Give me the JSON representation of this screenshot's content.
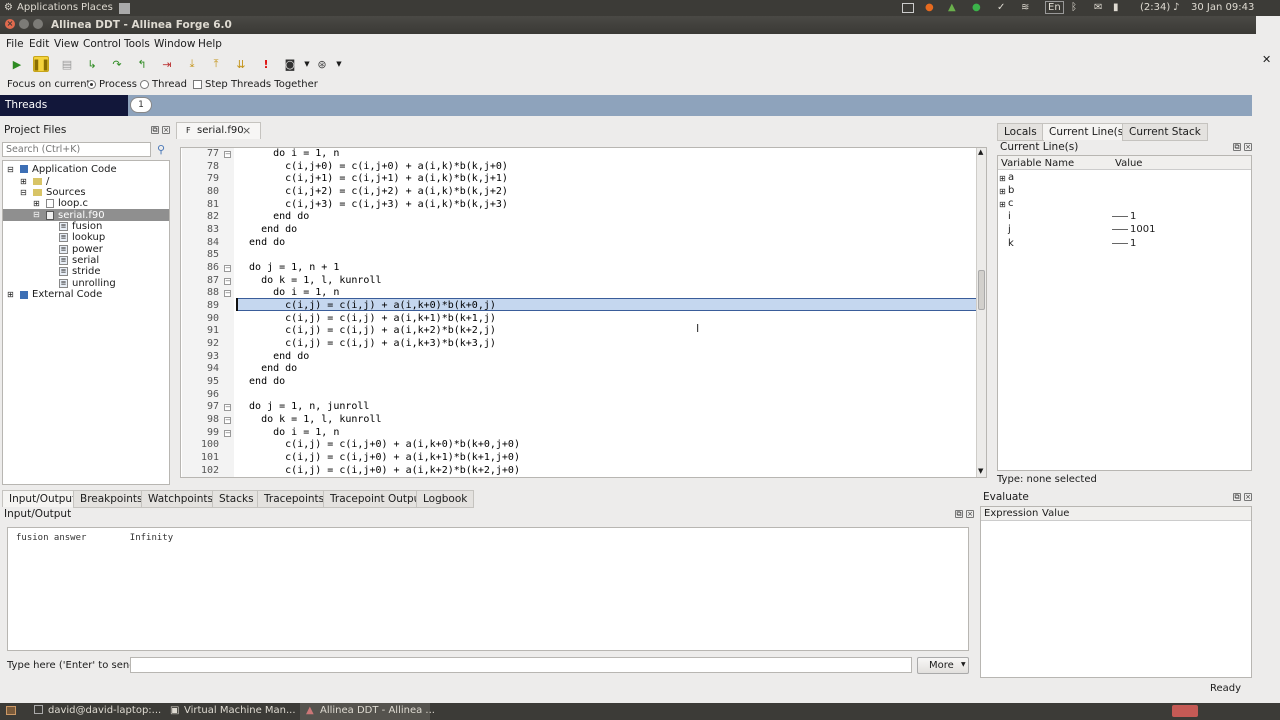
{
  "topbar": {
    "applications": "Applications",
    "places": "Places",
    "battery": "(2:34)",
    "lang": "En",
    "datetime": "30 Jan 09:43"
  },
  "window": {
    "title": "Allinea DDT - Allinea Forge 6.0"
  },
  "menu": [
    "File",
    "Edit",
    "View",
    "Control",
    "Tools",
    "Window",
    "Help"
  ],
  "focus": {
    "label": "Focus on current:",
    "process": "Process",
    "thread": "Thread",
    "step": "Step Threads Together"
  },
  "threads": {
    "label": "Threads",
    "count": "1"
  },
  "project": {
    "title": "Project Files",
    "search_placeholder": "Search (Ctrl+K)",
    "app_code": "Application Code",
    "root": "/",
    "sources": "Sources",
    "files": [
      "loop.c",
      "serial.f90"
    ],
    "functions": [
      "fusion",
      "lookup",
      "power",
      "serial",
      "stride",
      "unrolling"
    ],
    "external": "External Code"
  },
  "editor": {
    "tab": "serial.f90",
    "lines": [
      {
        "n": "77",
        "t": "      do i = 1, n"
      },
      {
        "n": "78",
        "t": "        c(i,j+0) = c(i,j+0) + a(i,k)*b(k,j+0)"
      },
      {
        "n": "79",
        "t": "        c(i,j+1) = c(i,j+1) + a(i,k)*b(k,j+1)"
      },
      {
        "n": "80",
        "t": "        c(i,j+2) = c(i,j+2) + a(i,k)*b(k,j+2)"
      },
      {
        "n": "81",
        "t": "        c(i,j+3) = c(i,j+3) + a(i,k)*b(k,j+3)"
      },
      {
        "n": "82",
        "t": "      end do"
      },
      {
        "n": "83",
        "t": "    end do"
      },
      {
        "n": "84",
        "t": "  end do"
      },
      {
        "n": "85",
        "t": ""
      },
      {
        "n": "86",
        "t": "  do j = 1, n + 1"
      },
      {
        "n": "87",
        "t": "    do k = 1, l, kunroll"
      },
      {
        "n": "88",
        "t": "      do i = 1, n"
      },
      {
        "n": "89",
        "t": "        c(i,j) = c(i,j) + a(i,k+0)*b(k+0,j)"
      },
      {
        "n": "90",
        "t": "        c(i,j) = c(i,j) + a(i,k+1)*b(k+1,j)"
      },
      {
        "n": "91",
        "t": "        c(i,j) = c(i,j) + a(i,k+2)*b(k+2,j)"
      },
      {
        "n": "92",
        "t": "        c(i,j) = c(i,j) + a(i,k+3)*b(k+3,j)"
      },
      {
        "n": "93",
        "t": "      end do"
      },
      {
        "n": "94",
        "t": "    end do"
      },
      {
        "n": "95",
        "t": "  end do"
      },
      {
        "n": "96",
        "t": ""
      },
      {
        "n": "97",
        "t": "  do j = 1, n, junroll"
      },
      {
        "n": "98",
        "t": "    do k = 1, l, kunroll"
      },
      {
        "n": "99",
        "t": "      do i = 1, n"
      },
      {
        "n": "100",
        "t": "        c(i,j) = c(i,j+0) + a(i,k+0)*b(k+0,j+0)"
      },
      {
        "n": "101",
        "t": "        c(i,j) = c(i,j+0) + a(i,k+1)*b(k+1,j+0)"
      },
      {
        "n": "102",
        "t": "        c(i,j) = c(i,j+0) + a(i,k+2)*b(k+2,j+0)"
      }
    ]
  },
  "right": {
    "tabs": [
      "Locals",
      "Current Line(s)",
      "Current Stack"
    ],
    "title": "Current Line(s)",
    "col_name": "Variable Name",
    "col_value": "Value",
    "vars": [
      {
        "n": "a",
        "v": ""
      },
      {
        "n": "b",
        "v": ""
      },
      {
        "n": "c",
        "v": ""
      },
      {
        "n": "i",
        "v": "1"
      },
      {
        "n": "j",
        "v": "1001"
      },
      {
        "n": "k",
        "v": "1"
      }
    ],
    "type": "Type: none selected"
  },
  "bottom": {
    "tabs": [
      "Input/Output",
      "Breakpoints",
      "Watchpoints",
      "Stacks",
      "Tracepoints",
      "Tracepoint Output",
      "Logbook"
    ],
    "title": "Input/Output",
    "output": "fusion answer        Infinity",
    "send_label": "Type here ('Enter' to send):",
    "more": "More"
  },
  "evaluate": {
    "title": "Evaluate",
    "col_expr": "Expression",
    "col_value": "Value"
  },
  "status": "Ready",
  "taskbar": [
    "david@david-laptop:...",
    "Virtual Machine Man...",
    "Allinea DDT - Allinea ..."
  ]
}
